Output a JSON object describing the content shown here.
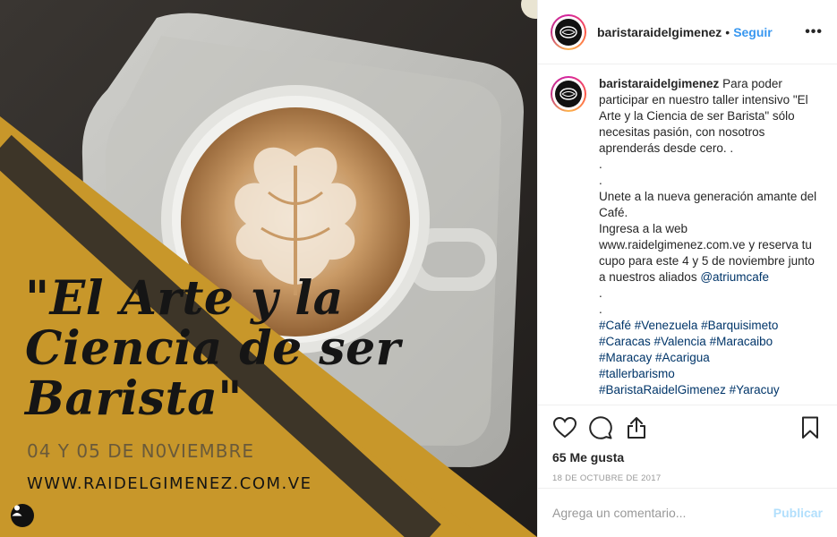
{
  "post": {
    "username": "baristaraidelgimenez",
    "follow_label": "Seguir",
    "separator": "•",
    "more_label": "•••",
    "poster": {
      "title_lines": [
        "\"El Arte y la",
        "Ciencia de ser",
        "Barista\""
      ],
      "dates": "04 Y 05 DE N0VIEMBRE",
      "website": "WWW.RAIDELGIMENEZ.COM.VE"
    }
  },
  "caption": {
    "username": "baristaraidelgimenez",
    "intro": "Para poder participar en nuestro taller intensivo \"El Arte y la Ciencia de ser Barista\" sólo necesitas pasión, con nosotros aprenderás desde cero. .",
    "dot1": ".",
    "dot2": ".",
    "line_unete": "Unete a la nueva generación amante del Café.",
    "line_ingresa": "Ingresa a la web",
    "line_web_pre": "www.raidelgimenez.com.ve y reserva tu cupo para este 4 y 5 de noviembre junto a nuestros aliados ",
    "mention": "@atriumcafe",
    "dot3": ".",
    "dot4": ".",
    "hashtags_1": "#Café #Venezuela #Barquisimeto",
    "hashtags_2": "#Caracas #Valencia #Maracaibo",
    "hashtags_3": "#Maracay #Acarigua",
    "hashtags_4": "#tallerbarismo",
    "hashtags_5": "#BaristaRaidelGimenez #Yaracuy"
  },
  "stats": {
    "likes": "65 Me gusta",
    "date": "18 DE OCTUBRE DE 2017"
  },
  "comment": {
    "placeholder": "Agrega un comentario...",
    "publish_label": "Publicar"
  },
  "colors": {
    "link": "#3897f0",
    "hashtag": "#003569",
    "gold": "#c8972a",
    "publish_disabled": "#b2dffc"
  }
}
